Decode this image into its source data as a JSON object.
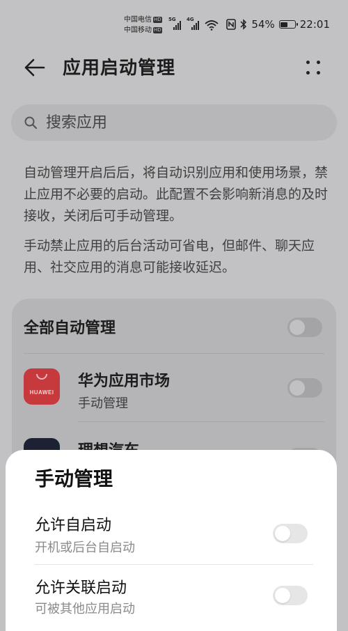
{
  "status_bar": {
    "carrier1": "中国电信",
    "carrier2": "中国移动",
    "hd_label": "HD",
    "network1": "5G",
    "network2": "4G",
    "battery": "54%",
    "time": "22:01",
    "battery_level": 0.54
  },
  "header": {
    "title": "应用启动管理",
    "back_icon": "arrow-left-icon",
    "more_icon": "more-dots-icon"
  },
  "search": {
    "placeholder": "搜索应用"
  },
  "descriptions": [
    "自动管理开启后后，将自动识别应用和使用场景，禁止应用不必要的启动。此配置不会影响新消息的及时接收，关闭后可手动管理。",
    "手动禁止应用的后台活动可省电，但邮件、聊天应用、社交应用的消息可能接收延迟。"
  ],
  "list": {
    "all_auto_label": "全部自动管理",
    "all_auto_on": false,
    "apps": [
      {
        "name": "华为应用市场",
        "status": "手动管理",
        "icon_text": "HUAWEI",
        "icon_color": "#c63a3e",
        "on": false
      },
      {
        "name": "理想汽车",
        "status": "",
        "icon_color": "#1c2233",
        "on": false
      }
    ]
  },
  "sheet": {
    "title": "手动管理",
    "options": [
      {
        "title": "允许自启动",
        "subtitle": "开机或后台自启动",
        "on": false
      },
      {
        "title": "允许关联启动",
        "subtitle": "可被其他应用启动",
        "on": false
      }
    ]
  }
}
